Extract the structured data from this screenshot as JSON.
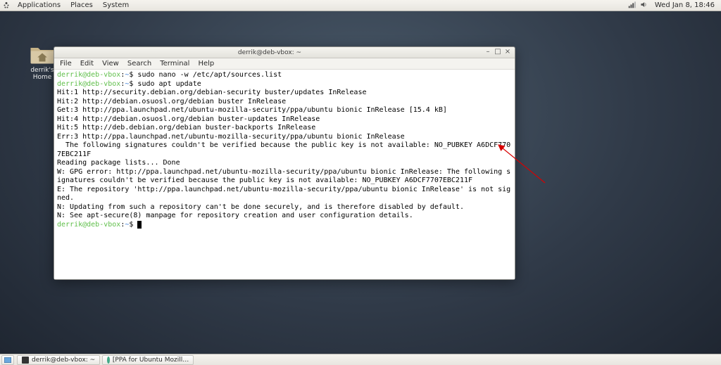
{
  "top_panel": {
    "menus": [
      "Applications",
      "Places",
      "System"
    ],
    "clock": "Wed Jan  8, 18:46"
  },
  "desktop": {
    "home_icon_label": "derrik's Home"
  },
  "window": {
    "title": "derrik@deb-vbox: ~",
    "menus": [
      "File",
      "Edit",
      "View",
      "Search",
      "Terminal",
      "Help"
    ],
    "min": "–",
    "max": "□",
    "close": "×"
  },
  "terminal": {
    "prompt_user": "derrik@deb-vbox",
    "prompt_sep": ":",
    "prompt_path": "~",
    "prompt_end": "$ ",
    "cmd1": "sudo nano -w /etc/apt/sources.list",
    "cmd2": "sudo apt update",
    "lines": [
      "Hit:1 http://security.debian.org/debian-security buster/updates InRelease",
      "Hit:2 http://debian.osuosl.org/debian buster InRelease",
      "Get:3 http://ppa.launchpad.net/ubuntu-mozilla-security/ppa/ubuntu bionic InRelease [15.4 kB]",
      "Hit:4 http://debian.osuosl.org/debian buster-updates InRelease",
      "Hit:5 http://deb.debian.org/debian buster-backports InRelease",
      "Err:3 http://ppa.launchpad.net/ubuntu-mozilla-security/ppa/ubuntu bionic InRelease",
      "  The following signatures couldn't be verified because the public key is not available: NO_PUBKEY A6DCF7707EBC211F",
      "Reading package lists... Done",
      "W: GPG error: http://ppa.launchpad.net/ubuntu-mozilla-security/ppa/ubuntu bionic InRelease: The following signatures couldn't be verified because the public key is not available: NO_PUBKEY A6DCF7707EBC211F",
      "E: The repository 'http://ppa.launchpad.net/ubuntu-mozilla-security/ppa/ubuntu bionic InRelease' is not signed.",
      "N: Updating from such a repository can't be done securely, and is therefore disabled by default.",
      "N: See apt-secure(8) manpage for repository creation and user configuration details."
    ]
  },
  "taskbar": {
    "items": [
      "derrik@deb-vbox: ~",
      "[PPA for Ubuntu Mozill…"
    ]
  }
}
